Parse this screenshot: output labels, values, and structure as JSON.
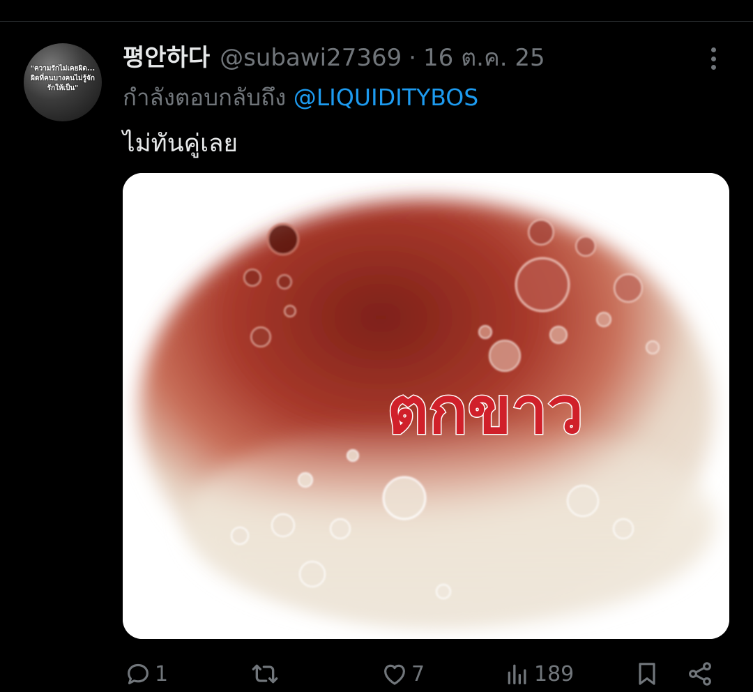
{
  "tweet": {
    "avatar_text": "\"ความรักไม่เคยผิด... ผิดที่คนบางคนไม่รู้จัก รักให้เป็น\"",
    "display_name": "평안하다",
    "handle": "@subawi27369",
    "separator": "·",
    "date": "16 ต.ค. 25",
    "replying_prefix": "กำลังตอบกลับถึง",
    "replying_to": "@LIQUIDITYBOS",
    "text": "ไม่ทันคู่เลย",
    "media_caption": "ตกขาว"
  },
  "actions": {
    "replies": "1",
    "reposts": "",
    "likes": "7",
    "views": "189"
  },
  "colors": {
    "background": "#000000",
    "primary_text": "#e7e9ea",
    "secondary_text": "#71767b",
    "link": "#1d9bf0",
    "caption_red": "#d0202a"
  },
  "icons": [
    "more-icon",
    "reply-icon",
    "repost-icon",
    "like-icon",
    "views-icon",
    "bookmark-icon",
    "share-icon"
  ]
}
